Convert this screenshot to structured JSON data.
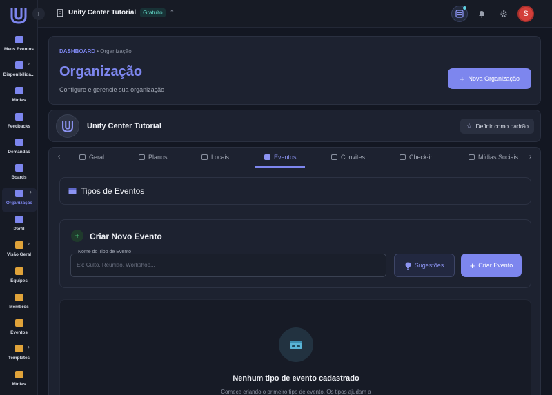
{
  "colors": {
    "accent": "#7d86ee",
    "background": "#131722",
    "card": "#1d2230",
    "badge": "#62d6c6",
    "avatar": "#d33f3a"
  },
  "sidebar": {
    "items": [
      {
        "label": "Meus Eventos",
        "icon": "calendar-icon",
        "color": "#7d86ee",
        "chevron": false,
        "active": false
      },
      {
        "label": "Disponibilida...",
        "icon": "calendar-icon",
        "color": "#7d86ee",
        "chevron": true,
        "active": false
      },
      {
        "label": "Mídias",
        "icon": "media-icon",
        "color": "#7d86ee",
        "chevron": false,
        "active": false
      },
      {
        "label": "Feedbacks",
        "icon": "chat-icon",
        "color": "#7d86ee",
        "chevron": false,
        "active": false
      },
      {
        "label": "Demandas",
        "icon": "inbox-icon",
        "color": "#7d86ee",
        "chevron": false,
        "active": false
      },
      {
        "label": "Boards",
        "icon": "board-icon",
        "color": "#7d86ee",
        "chevron": false,
        "active": false
      },
      {
        "label": "Organização",
        "icon": "building-icon",
        "color": "#7d86ee",
        "chevron": true,
        "active": true
      },
      {
        "label": "Perfil",
        "icon": "user-icon",
        "color": "#7d86ee",
        "chevron": false,
        "active": false
      },
      {
        "label": "Visão Geral",
        "icon": "chart-icon",
        "color": "#e0a33a",
        "chevron": true,
        "active": false
      },
      {
        "label": "Equipes",
        "icon": "team-icon",
        "color": "#e0a33a",
        "chevron": false,
        "active": false
      },
      {
        "label": "Membros",
        "icon": "user-icon",
        "color": "#e0a33a",
        "chevron": false,
        "active": false
      },
      {
        "label": "Eventos",
        "icon": "calendar-icon",
        "color": "#e0a33a",
        "chevron": false,
        "active": false
      },
      {
        "label": "Templates",
        "icon": "template-icon",
        "color": "#e0a33a",
        "chevron": true,
        "active": false
      },
      {
        "label": "Mídias",
        "icon": "media-icon",
        "color": "#e0a33a",
        "chevron": false,
        "active": false
      }
    ]
  },
  "topbar": {
    "org_name": "Unity Center Tutorial",
    "plan_badge": "Gratuito",
    "avatar_initial": "S"
  },
  "header": {
    "breadcrumb_root": "DASHBOARD",
    "breadcrumb_sep": "•",
    "breadcrumb_current": "Organização",
    "title": "Organização",
    "subtitle": "Configure e gerencie sua organização",
    "new_org_button": "Nova Organização"
  },
  "org_card": {
    "name": "Unity Center Tutorial",
    "set_default_button": "Definir como padrão"
  },
  "tabs": [
    {
      "label": "Geral",
      "icon": "id-card-icon",
      "active": false
    },
    {
      "label": "Planos",
      "icon": "document-icon",
      "active": false
    },
    {
      "label": "Locais",
      "icon": "building-icon",
      "active": false
    },
    {
      "label": "Eventos",
      "icon": "ticket-icon",
      "active": true
    },
    {
      "label": "Convites",
      "icon": "link-icon",
      "active": false
    },
    {
      "label": "Check-in",
      "icon": "qr-icon",
      "active": false
    },
    {
      "label": "Mídias Sociais",
      "icon": "share-icon",
      "active": false
    }
  ],
  "event_types": {
    "section_title": "Tipos de Eventos",
    "create_title": "Criar Novo Evento",
    "field_label": "Nome do Tipo de Evento",
    "field_placeholder": "Ex: Culto, Reunião, Workshop...",
    "field_value": "",
    "suggestions_button": "Sugestões",
    "create_button": "Criar Evento",
    "empty_title": "Nenhum tipo de evento cadastrado",
    "empty_subtitle": "Comece criando o primeiro tipo de evento. Os tipos ajudam a"
  }
}
